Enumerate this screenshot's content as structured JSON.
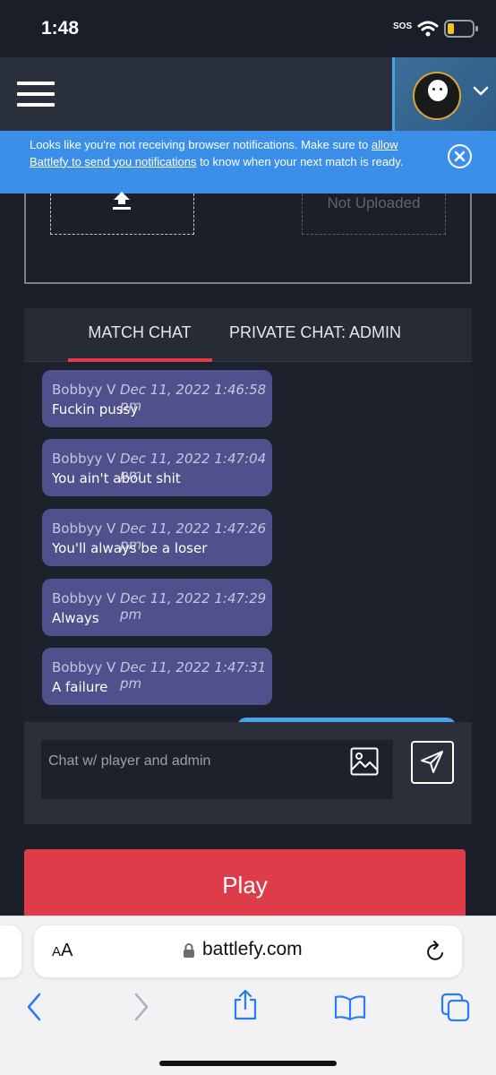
{
  "status_bar": {
    "time": "1:48",
    "sos": "SOS",
    "wifi_icon": "wifi-icon",
    "battery_level": 0.2,
    "battery_color": "#f4c430"
  },
  "nav": {
    "menu_icon": "hamburger-menu-icon",
    "avatar_icon": "user-avatar",
    "dropdown_icon": "chevron-down-icon"
  },
  "notification": {
    "text_before": "Looks like you're not receiving browser notifications. Make sure to ",
    "link": "allow Battlefy to send you notifications",
    "text_after": " to know when your next match is ready.",
    "close_icon": "close-circle-icon",
    "color": "#3b8fe8"
  },
  "upload": {
    "upload_icon": "upload-icon",
    "status": "Not Uploaded"
  },
  "chat": {
    "tabs": [
      {
        "label": "MATCH CHAT",
        "active": true
      },
      {
        "label": "PRIVATE CHAT: ADMIN",
        "active": false
      }
    ],
    "messages": [
      {
        "author": "Bobbyy V",
        "time": "Dec 11, 2022 1:46:58 pm",
        "text": "Fuckin pussy"
      },
      {
        "author": "Bobbyy V",
        "time": "Dec 11, 2022 1:47:04 pm",
        "text": "You ain't about shit"
      },
      {
        "author": "Bobbyy V",
        "time": "Dec 11, 2022 1:47:26 pm",
        "text": "You'll always be a loser"
      },
      {
        "author": "Bobbyy V",
        "time": "Dec 11, 2022 1:47:29 pm",
        "text": "Always"
      },
      {
        "author": "Bobbyy V",
        "time": "Dec 11, 2022 1:47:31 pm",
        "text": "A failure"
      }
    ],
    "input_placeholder": "Chat w/ player and admin",
    "image_icon": "image-attach-icon",
    "send_icon": "send-icon",
    "bubble_color": "#4f518c",
    "outgoing_bubble_color": "#4aa3e8",
    "accent_color": "#e23b49"
  },
  "play_button": {
    "label": "Play",
    "color": "#dd3c48"
  },
  "browser": {
    "aa_large": "A",
    "aa_small": "A",
    "url": "battlefy.com",
    "lock_icon": "lock-icon",
    "reload_icon": "reload-icon",
    "toolbar_icons": [
      "back-icon",
      "forward-icon",
      "share-icon",
      "bookmarks-icon",
      "tabs-icon"
    ]
  }
}
